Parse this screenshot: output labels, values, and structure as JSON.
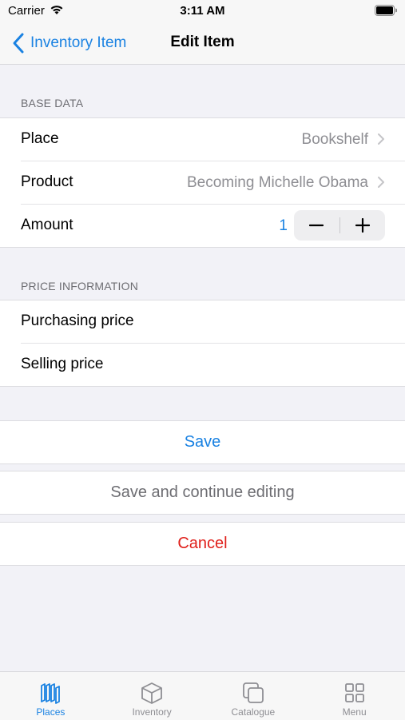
{
  "status_bar": {
    "carrier": "Carrier",
    "time": "3:11 AM"
  },
  "nav": {
    "back_label": "Inventory Item",
    "title": "Edit Item"
  },
  "base_data": {
    "header": "BASE DATA",
    "place": {
      "label": "Place",
      "value": "Bookshelf"
    },
    "product": {
      "label": "Product",
      "value": "Becoming Michelle Obama"
    },
    "amount": {
      "label": "Amount",
      "value": "1",
      "decrement": "−",
      "increment": "+"
    }
  },
  "price_information": {
    "header": "PRICE INFORMATION",
    "purchasing_price": {
      "label": "Purchasing price"
    },
    "selling_price": {
      "label": "Selling price"
    }
  },
  "actions": {
    "save": "Save",
    "save_continue": "Save and continue editing",
    "cancel": "Cancel"
  },
  "tabs": [
    {
      "label": "Places",
      "icon": "places-icon",
      "active": true
    },
    {
      "label": "Inventory",
      "icon": "box-icon",
      "active": false
    },
    {
      "label": "Catalogue",
      "icon": "catalogue-icon",
      "active": false
    },
    {
      "label": "Menu",
      "icon": "grid-icon",
      "active": false
    }
  ],
  "colors": {
    "accent": "#1a82e2",
    "destructive": "#e0201b",
    "secondary": "#8e8e93",
    "background": "#f2f2f7"
  }
}
